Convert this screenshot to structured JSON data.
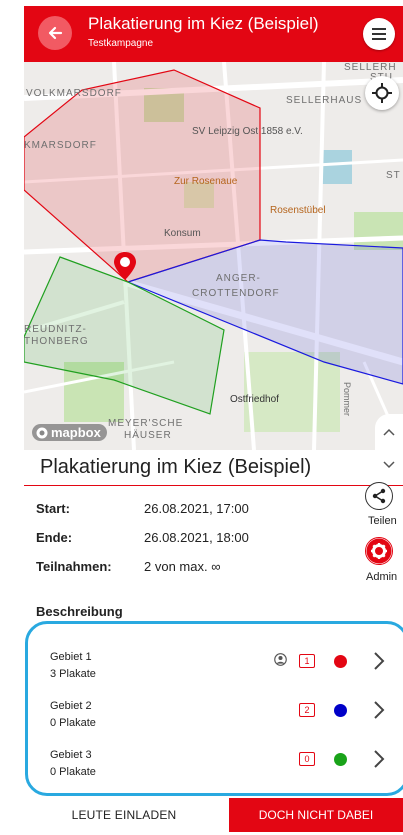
{
  "header": {
    "title": "Plakatierung im Kiez (Beispiel)",
    "subtitle": "Testkampagne",
    "accent_color": "#e30613",
    "back_icon": "arrow-left-icon",
    "menu_icon": "hamburger-menu-icon"
  },
  "map": {
    "labels": {
      "volkmarsdorf": "VOLKMARSDORF",
      "kmarsdorf": "KMARSDORF",
      "sellerhaus": "SELLERHAUS",
      "sellerh_top": "SELLERH",
      "stu": "STU",
      "st": "ST",
      "anger1": "ANGER-",
      "anger2": "CROTTENDORF",
      "reudnitz1": "REUDNITZ-",
      "reudnitz2": "THONBERG",
      "meyer1": "MEYER'SCHE",
      "meyer2": "HÄUSER",
      "pommer": "Pommer"
    },
    "pois": {
      "sv": "SV Leipzig Ost 1858 e.V.",
      "rosenaue": "Zur Rosenaue",
      "rosenstuebel": "Rosenstübel",
      "konsum": "Konsum",
      "friedhof": "Ostfriedhof"
    },
    "attribution": "mapbox",
    "area_colors": {
      "red": "#e30613",
      "blue": "#1a1adf",
      "green": "#20a020"
    }
  },
  "title_row": {
    "title": "Plakatierung im Kiez (Beispiel)"
  },
  "info": {
    "start_label": "Start:",
    "start_value": "26.08.2021, 17:00",
    "end_label": "Ende:",
    "end_value": "26.08.2021, 18:00",
    "participants_label": "Teilnahmen:",
    "participants_value": "2 von max. ∞"
  },
  "side_actions": {
    "share_label": "Teilen",
    "admin_label": "Admin"
  },
  "description": {
    "heading": "Beschreibung"
  },
  "areas": [
    {
      "name": "Gebiet 1",
      "count": "3 Plakate",
      "badge": "1",
      "color": "#e30613",
      "has_user": true
    },
    {
      "name": "Gebiet 2",
      "count": "0 Plakate",
      "badge": "2",
      "color": "#0000c8",
      "has_user": false
    },
    {
      "name": "Gebiet 3",
      "count": "0 Plakate",
      "badge": "0",
      "color": "#19a319",
      "has_user": false
    }
  ],
  "actions": {
    "invite": "LEUTE EINLADEN",
    "leave": "DOCH NICHT DABEI"
  }
}
